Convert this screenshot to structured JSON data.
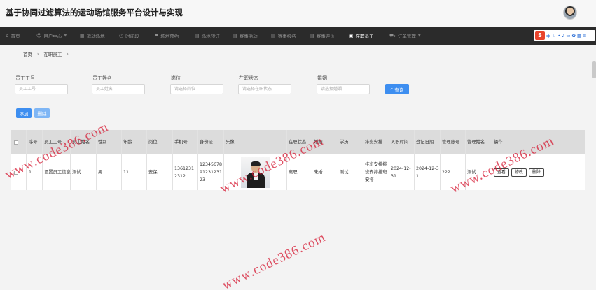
{
  "app": {
    "title": "基于协同过滤算法的运动场馆服务平台设计与实现"
  },
  "nav": {
    "items": [
      {
        "label": "首页",
        "icon": "home-icon",
        "caret": false
      },
      {
        "label": "用户中心",
        "icon": "user-icon",
        "caret": true
      },
      {
        "label": "运动场地",
        "icon": "grid-icon",
        "caret": false
      },
      {
        "label": "时间段",
        "icon": "clock-icon",
        "caret": false
      },
      {
        "label": "场地预约",
        "icon": "flag-icon",
        "caret": false
      },
      {
        "label": "场地预订",
        "icon": "list-icon",
        "caret": false
      },
      {
        "label": "赛事活动",
        "icon": "list-icon",
        "caret": false
      },
      {
        "label": "赛事报名",
        "icon": "list-icon",
        "caret": false
      },
      {
        "label": "赛事评价",
        "icon": "list-icon",
        "caret": false
      },
      {
        "label": "在职员工",
        "icon": "briefcase-icon",
        "caret": false,
        "active": true
      },
      {
        "label": "订单管理",
        "icon": "cart-icon",
        "caret": true
      }
    ]
  },
  "ime": {
    "logo": "S",
    "label": "中"
  },
  "breadcrumb": [
    "首页",
    "在职员工"
  ],
  "search": {
    "fields": [
      {
        "label": "员工工号",
        "placeholder": "员工工号"
      },
      {
        "label": "员工姓名",
        "placeholder": "员工姓名"
      },
      {
        "label": "岗位",
        "placeholder": "请选择岗位"
      },
      {
        "label": "在职状态",
        "placeholder": "请选择在职状态"
      },
      {
        "label": "婚姻",
        "placeholder": "请选择婚姻"
      }
    ],
    "button_label": "查询"
  },
  "actions": {
    "add_label": "添加",
    "delete_label": "删除"
  },
  "table": {
    "headers": [
      "序号",
      "员工工号",
      "员工姓名",
      "性别",
      "年龄",
      "岗位",
      "手机号",
      "身份证",
      "头像",
      "在职状态",
      "婚姻",
      "学历",
      "排班安排",
      "入职时间",
      "登记日期",
      "管理账号",
      "管理姓名",
      "操作"
    ],
    "rows": [
      {
        "index": "1",
        "emp_no": "设置员工信息",
        "name": "测试",
        "gender": "男",
        "age": "11",
        "post": "安保",
        "phone": "13612312312",
        "id_card": "123456789123123123",
        "status": "离职",
        "marriage": "未婚",
        "education": "测试",
        "schedule": "排班安排排班安排排班安排",
        "hire_date": "2024-12-31",
        "register_date": "2024-12-31",
        "account": "222",
        "manager_name": "测试"
      }
    ],
    "row_actions": [
      "查看",
      "修改",
      "删除"
    ]
  },
  "watermark": {
    "text": "www.code386.com",
    "color": "#d61832"
  }
}
